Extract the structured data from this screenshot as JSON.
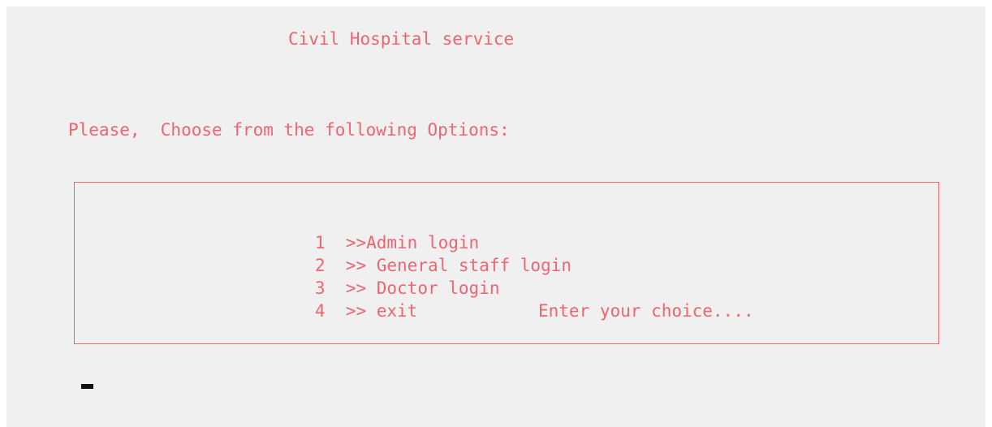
{
  "console": {
    "title": "Civil Hospital service",
    "prompt": "Please,  Choose from the following Options:",
    "menu": {
      "options": [
        {
          "number": "1",
          "label": ">>Admin login"
        },
        {
          "number": "2",
          "label": ">> General staff login"
        },
        {
          "number": "3",
          "label": ">> Doctor login"
        },
        {
          "number": "4",
          "label": ">> exit"
        }
      ],
      "choice_prompt": "Enter your choice...."
    }
  },
  "colors": {
    "text": "#f06470",
    "background": "#f0f0f0",
    "cursor": "#111111"
  }
}
